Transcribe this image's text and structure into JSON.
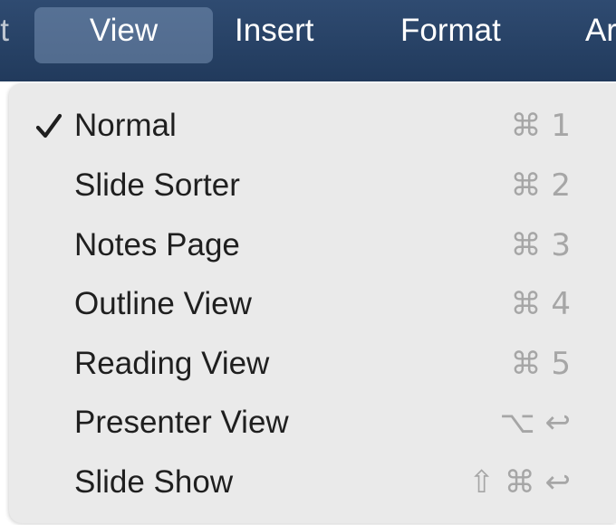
{
  "menubar": {
    "prev_fragment": "t",
    "active_menu": "View",
    "insert": "Insert",
    "format": "Format",
    "next_fragment": "Ar"
  },
  "view_menu": {
    "items": [
      {
        "label": "Normal",
        "checked": true,
        "shortcut": "⌘ 1"
      },
      {
        "label": "Slide Sorter",
        "checked": false,
        "shortcut": "⌘ 2"
      },
      {
        "label": "Notes Page",
        "checked": false,
        "shortcut": "⌘ 3"
      },
      {
        "label": "Outline View",
        "checked": false,
        "shortcut": "⌘ 4"
      },
      {
        "label": "Reading View",
        "checked": false,
        "shortcut": "⌘ 5"
      },
      {
        "label": "Presenter View",
        "checked": false,
        "shortcut": "⌥ ↩"
      },
      {
        "label": "Slide Show",
        "checked": false,
        "shortcut": "⇧ ⌘ ↩"
      }
    ]
  },
  "colors": {
    "menubar_background": "#2f4b71",
    "menu_background": "#eaeaea",
    "shortcut_text": "#a6a6a6",
    "label_text": "#1f1f1f"
  },
  "icons": {
    "checked_item": "checkmark-icon"
  }
}
